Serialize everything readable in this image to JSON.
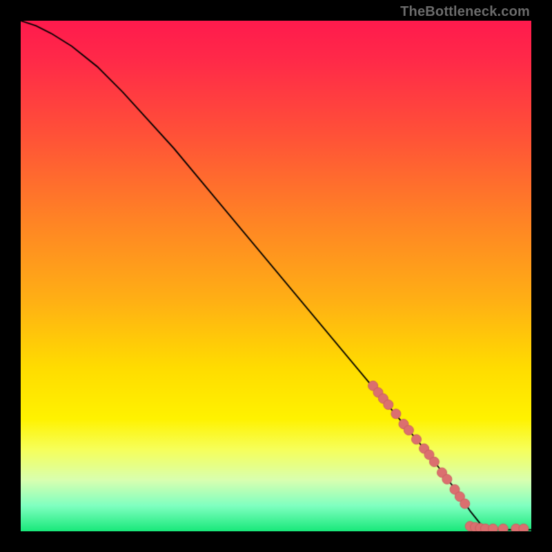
{
  "watermark": {
    "text": "TheBottleneck.com"
  },
  "colors": {
    "background_frame": "#000000",
    "curve": "#000000",
    "marker_fill": "#db6f6f",
    "marker_stroke": "#c95f5f"
  },
  "chart_data": {
    "type": "line",
    "title": "",
    "xlabel": "",
    "ylabel": "",
    "xlim": [
      0,
      100
    ],
    "ylim": [
      0,
      100
    ],
    "grid": false,
    "legend": false,
    "series": [
      {
        "name": "bottleneck-curve",
        "x": [
          0,
          3,
          6,
          10,
          15,
          20,
          30,
          40,
          50,
          60,
          70,
          80,
          86,
          88,
          90,
          92,
          94,
          96,
          98,
          100
        ],
        "y": [
          100,
          99,
          97.5,
          95,
          91,
          86,
          75,
          63,
          51,
          39,
          27,
          15,
          7,
          4,
          1.5,
          0.5,
          0.3,
          0.3,
          0.3,
          0.3
        ]
      }
    ],
    "markers": [
      {
        "name": "highlighted-segment-diagonal",
        "points": [
          {
            "x": 69,
            "y": 28.5
          },
          {
            "x": 70,
            "y": 27.2
          },
          {
            "x": 71,
            "y": 26.0
          },
          {
            "x": 72,
            "y": 24.8
          },
          {
            "x": 73.5,
            "y": 23.0
          },
          {
            "x": 75,
            "y": 21.0
          },
          {
            "x": 76,
            "y": 19.8
          },
          {
            "x": 77.5,
            "y": 18.0
          },
          {
            "x": 79,
            "y": 16.2
          },
          {
            "x": 80,
            "y": 15.0
          },
          {
            "x": 81,
            "y": 13.6
          },
          {
            "x": 82.5,
            "y": 11.5
          },
          {
            "x": 83.5,
            "y": 10.2
          },
          {
            "x": 85,
            "y": 8.2
          },
          {
            "x": 86,
            "y": 6.8
          },
          {
            "x": 87,
            "y": 5.4
          }
        ]
      },
      {
        "name": "highlighted-segment-flat",
        "points": [
          {
            "x": 88,
            "y": 1.0
          },
          {
            "x": 89,
            "y": 0.8
          },
          {
            "x": 90,
            "y": 0.6
          },
          {
            "x": 91,
            "y": 0.5
          },
          {
            "x": 92.5,
            "y": 0.5
          },
          {
            "x": 94.5,
            "y": 0.5
          },
          {
            "x": 97,
            "y": 0.5
          },
          {
            "x": 98.5,
            "y": 0.5
          }
        ]
      }
    ]
  }
}
